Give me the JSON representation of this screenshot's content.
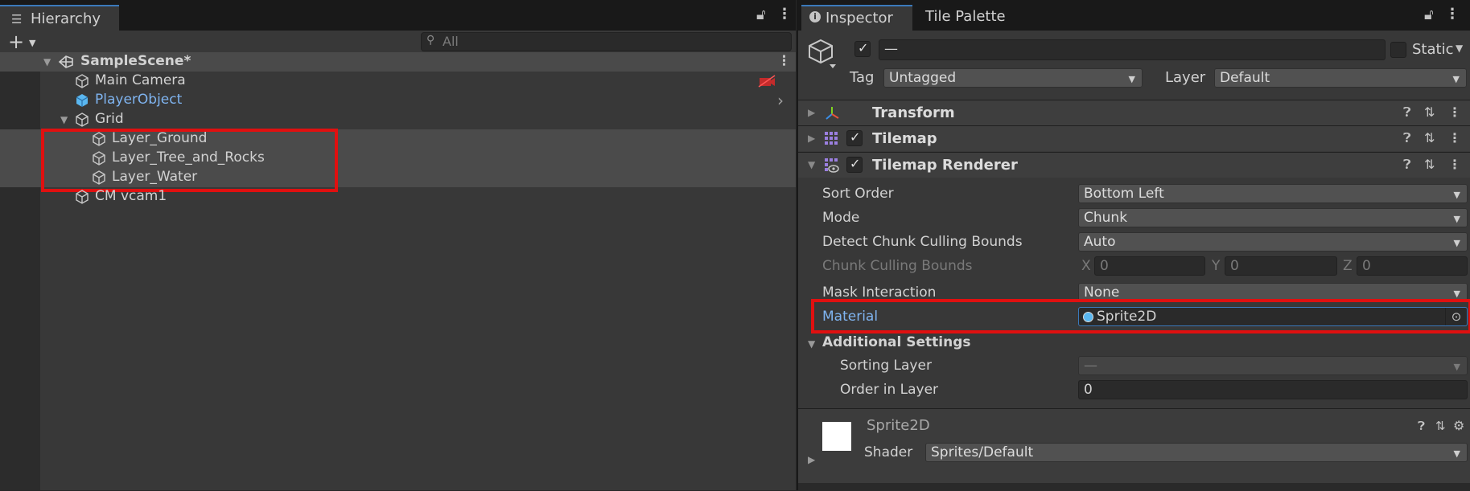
{
  "hierarchy": {
    "tab_label": "Hierarchy",
    "search_placeholder": "All",
    "scene": "SampleScene*",
    "items": [
      {
        "label": "Main Camera"
      },
      {
        "label": "PlayerObject"
      },
      {
        "label": "Grid"
      },
      {
        "label": "Layer_Ground"
      },
      {
        "label": "Layer_Tree_and_Rocks"
      },
      {
        "label": "Layer_Water"
      },
      {
        "label": "CM vcam1"
      }
    ]
  },
  "inspector": {
    "tabs": [
      "Inspector",
      "Tile Palette"
    ],
    "object_name": "—",
    "static_label": "Static",
    "tag_label": "Tag",
    "tag_value": "Untagged",
    "layer_label": "Layer",
    "layer_value": "Default",
    "components": [
      "Transform",
      "Tilemap",
      "Tilemap Renderer"
    ],
    "props": {
      "sort_order": {
        "label": "Sort Order",
        "value": "Bottom Left"
      },
      "mode": {
        "label": "Mode",
        "value": "Chunk"
      },
      "detect": {
        "label": "Detect Chunk Culling Bounds",
        "value": "Auto"
      },
      "bounds": {
        "label": "Chunk Culling Bounds",
        "x_label": "X",
        "x": "0",
        "y_label": "Y",
        "y": "0",
        "z_label": "Z",
        "z": "0"
      },
      "mask": {
        "label": "Mask Interaction",
        "value": "None"
      },
      "material": {
        "label": "Material",
        "value": "Sprite2D"
      }
    },
    "additional": {
      "title": "Additional Settings",
      "sorting_layer_label": "Sorting Layer",
      "sorting_layer_value": "—",
      "order_label": "Order in Layer",
      "order_value": "0"
    },
    "material_preview": {
      "name": "Sprite2D",
      "shader_label": "Shader",
      "shader_value": "Sprites/Default"
    }
  },
  "colors": {
    "accent": "#3a79bb",
    "highlight": "#e01010",
    "link": "#7fb4f0"
  }
}
